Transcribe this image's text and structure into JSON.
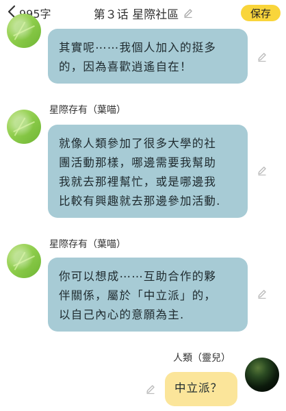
{
  "header": {
    "back_label": "995字",
    "title": "第３话  星際社區",
    "save_label": "保存"
  },
  "messages": [
    {
      "lines": [
        "其實呢⋯⋯我個人加入的挺多",
        "的，因為喜歡逍遙自在！"
      ]
    },
    {
      "sender": "星際存有（葉喵）",
      "lines": [
        "就像人類參加了很多大學的社",
        "團活動那樣，哪邊需要我幫助",
        "我就去那裡幫忙，或是哪邊我",
        "比較有興趣就去那邊參加活動."
      ]
    },
    {
      "sender": "星際存有（葉喵）",
      "lines": [
        "你可以想成⋯⋯互助合作的夥",
        "伴關係，屬於「中立派」的，",
        "以自己內心的意願為主."
      ]
    },
    {
      "sender": "人類（靈兒）",
      "lines": [
        "中立派？"
      ]
    }
  ],
  "colors": {
    "accent": "#f9d53b",
    "bubble_partner": "#a7cbd5",
    "bubble_user": "#fbe59a"
  },
  "icons": {
    "back": "chevron-left-icon",
    "edit": "pencil-icon"
  }
}
